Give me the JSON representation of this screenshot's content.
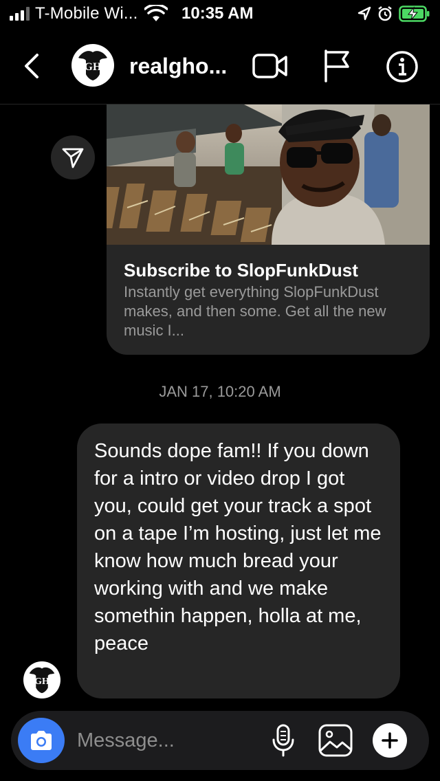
{
  "status_bar": {
    "carrier": "T-Mobile Wi...",
    "time": "10:35 AM",
    "battery_color": "#4cd964"
  },
  "header": {
    "username": "realgho..."
  },
  "link_card": {
    "title": "Subscribe to SlopFunkDust",
    "description": "Instantly get everything SlopFunkDust makes, and then some. Get all the new music I..."
  },
  "timestamp": "JAN 17, 10:20 AM",
  "message": {
    "text": "Sounds dope fam!! If you down for a intro or video drop I got you, could get your track a spot on a tape I’m hosting, just let me know how much bread your working with and we make somethin happen, holla at me, peace"
  },
  "composer": {
    "placeholder": "Message...",
    "camera_color": "#3b7cf5"
  }
}
